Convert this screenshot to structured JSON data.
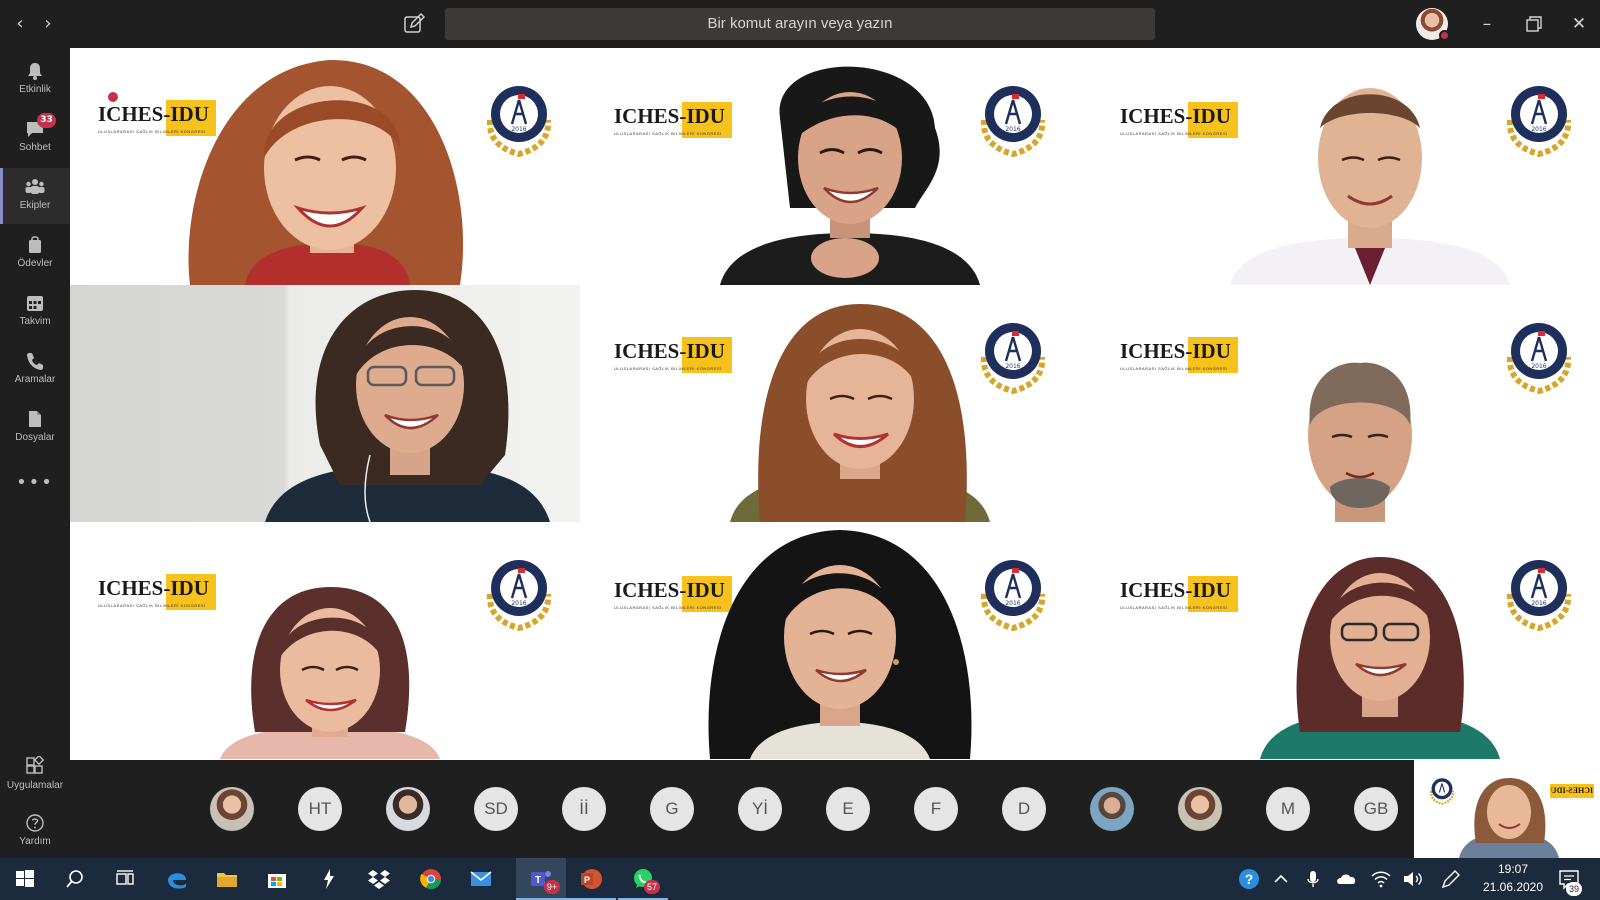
{
  "titlebar": {
    "search_placeholder": "Bir komut arayın veya yazın",
    "nav_back_glyph": "‹",
    "nav_forward_glyph": "›",
    "minimize_glyph": "–",
    "close_glyph": "✕"
  },
  "rail": {
    "items": [
      {
        "label": "Etkinlik",
        "icon": "bell-icon"
      },
      {
        "label": "Sohbet",
        "icon": "chat-icon",
        "badge": "33"
      },
      {
        "label": "Ekipler",
        "icon": "teams-icon"
      },
      {
        "label": "Ödevler",
        "icon": "assignments-icon"
      },
      {
        "label": "Takvim",
        "icon": "calendar-icon"
      },
      {
        "label": "Aramalar",
        "icon": "phone-icon"
      },
      {
        "label": "Dosyalar",
        "icon": "files-icon"
      }
    ],
    "more_glyph": "•••",
    "bottom": [
      {
        "label": "Uygulamalar",
        "icon": "apps-icon"
      },
      {
        "label": "Yardım",
        "icon": "help-icon"
      }
    ]
  },
  "meeting": {
    "brand_text": "ICHES-IDU",
    "brand_subtitle": "ULUSLARARASI SAĞLIK BİLİMLERİ KONGRESİ",
    "seal_year": "2016",
    "colors": {
      "brand_yellow": "#f7c21c",
      "seal_navy": "#1f2f5c",
      "laurel_gold": "#d7a628"
    }
  },
  "participants": [
    {
      "initials": "",
      "type": "photo"
    },
    {
      "initials": "HT",
      "type": "initials"
    },
    {
      "initials": "",
      "type": "photo"
    },
    {
      "initials": "SD",
      "type": "initials"
    },
    {
      "initials": "İİ",
      "type": "initials"
    },
    {
      "initials": "G",
      "type": "initials"
    },
    {
      "initials": "Yİ",
      "type": "initials"
    },
    {
      "initials": "E",
      "type": "initials"
    },
    {
      "initials": "F",
      "type": "initials"
    },
    {
      "initials": "D",
      "type": "initials"
    },
    {
      "initials": "",
      "type": "photo"
    },
    {
      "initials": "",
      "type": "photo"
    },
    {
      "initials": "M",
      "type": "initials"
    },
    {
      "initials": "GB",
      "type": "initials"
    }
  ],
  "self_view": {
    "brand_text": "ICHES-IDU"
  },
  "taskbar": {
    "teams_badge": "9+",
    "whatsapp_badge": "57",
    "time": "19:07",
    "date": "21.06.2020",
    "notifications_count": "39"
  }
}
